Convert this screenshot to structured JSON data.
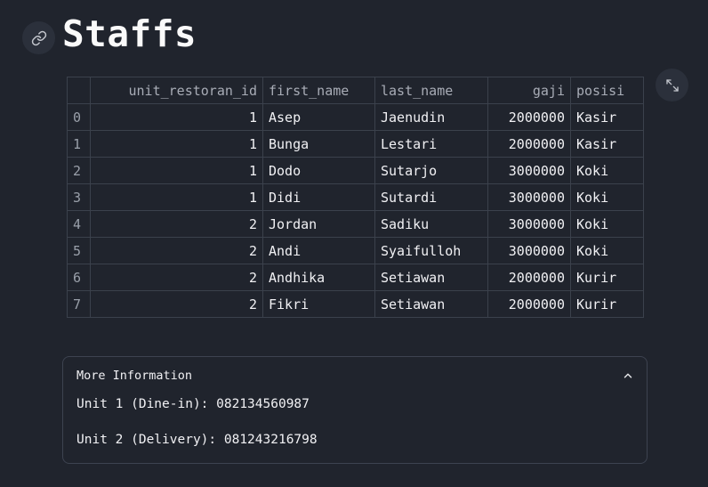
{
  "page": {
    "title": "Staffs"
  },
  "table": {
    "columns": [
      "",
      "unit_restoran_id",
      "first_name",
      "last_name",
      "gaji",
      "posisi"
    ],
    "rows": [
      [
        "0",
        "1",
        "Asep",
        "Jaenudin",
        "2000000",
        "Kasir"
      ],
      [
        "1",
        "1",
        "Bunga",
        "Lestari",
        "2000000",
        "Kasir"
      ],
      [
        "2",
        "1",
        "Dodo",
        "Sutarjo",
        "3000000",
        "Koki"
      ],
      [
        "3",
        "1",
        "Didi",
        "Sutardi",
        "3000000",
        "Koki"
      ],
      [
        "4",
        "2",
        "Jordan",
        "Sadiku",
        "3000000",
        "Koki"
      ],
      [
        "5",
        "2",
        "Andi",
        "Syaifulloh",
        "3000000",
        "Koki"
      ],
      [
        "6",
        "2",
        "Andhika",
        "Setiawan",
        "2000000",
        "Kurir"
      ],
      [
        "7",
        "2",
        "Fikri",
        "Setiawan",
        "2000000",
        "Kurir"
      ]
    ]
  },
  "expander": {
    "label": "More Information",
    "lines": [
      "Unit 1 (Dine-in): 082134560987",
      "Unit 2 (Delivery): 081243216798"
    ]
  },
  "icons": {
    "anchor": "link-icon",
    "fullscreen": "expand-icon",
    "toggle": "chevron-up-icon"
  }
}
